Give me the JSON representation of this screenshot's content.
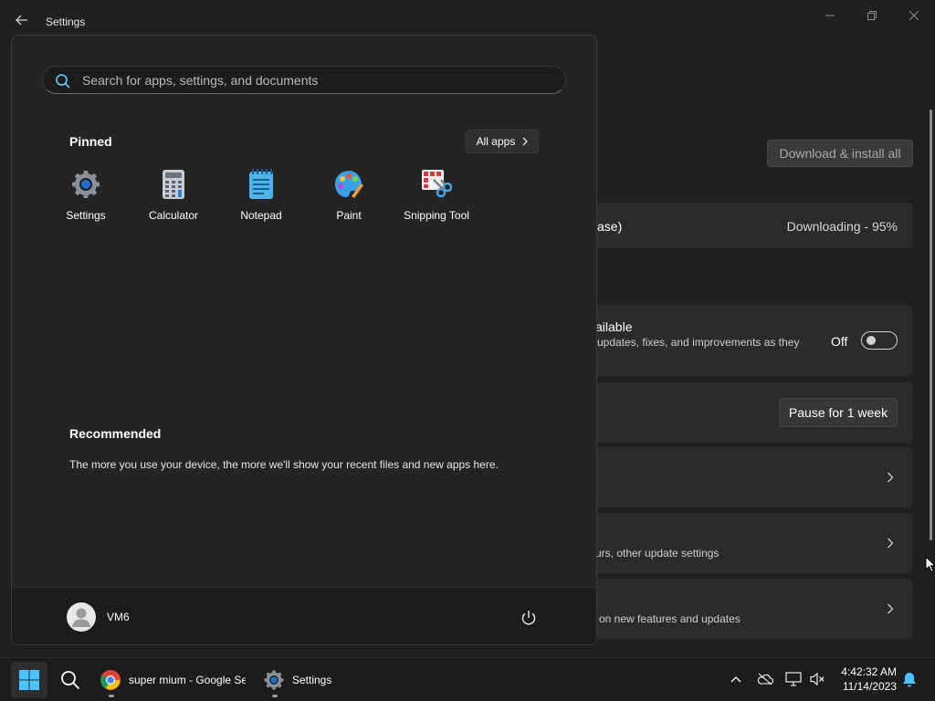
{
  "window": {
    "title": "Settings"
  },
  "settings": {
    "download_all_label": "Download & install all",
    "update_item_partial": "ase)",
    "update_status": "Downloading - 95%",
    "get_latest_title_partial": "ailable",
    "get_latest_desc_partial": "updates, fixes, and improvements as they",
    "toggle_state_label": "Off",
    "pause_label": "Pause for 1 week",
    "advanced_desc_partial": "urs, other update settings",
    "insider_desc_partial": "on new features and updates"
  },
  "start_menu": {
    "search_placeholder": "Search for apps, settings, and documents",
    "pinned_title": "Pinned",
    "all_apps_label": "All apps",
    "pinned_apps": [
      {
        "label": "Settings",
        "icon": "settings-gear-icon"
      },
      {
        "label": "Calculator",
        "icon": "calculator-icon"
      },
      {
        "label": "Notepad",
        "icon": "notepad-icon"
      },
      {
        "label": "Paint",
        "icon": "paint-palette-icon"
      },
      {
        "label": "Snipping Tool",
        "icon": "snipping-tool-icon"
      }
    ],
    "recommended_title": "Recommended",
    "recommended_text": "The more you use your device, the more we'll show your recent files and new apps here.",
    "user_name": "VM6"
  },
  "taskbar": {
    "chrome_label": "super mium - Google Se",
    "settings_label": "Settings",
    "time": "4:42:32 AM",
    "date": "11/14/2023"
  },
  "colors": {
    "accent": "#60cdff",
    "background": "#202020",
    "start_menu_bg": "#242424",
    "taskbar_bg": "#1c1c1c"
  }
}
